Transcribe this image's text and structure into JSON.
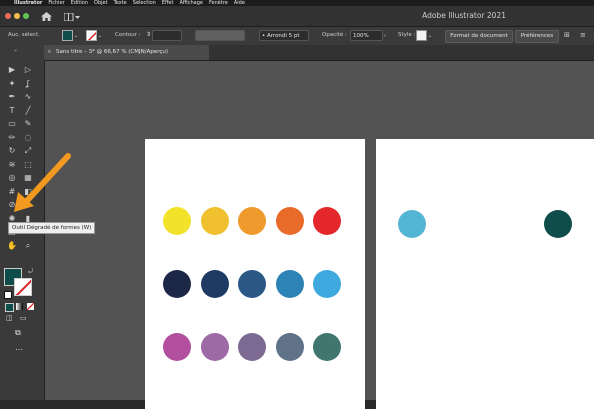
{
  "menubar": {
    "app": "Illustrator",
    "items": [
      "Fichier",
      "Edition",
      "Objet",
      "Texte",
      "Sélection",
      "Effet",
      "Affichage",
      "Fenêtre",
      "Aide"
    ]
  },
  "titlebar": {
    "title": "Adobe Illustrator 2021"
  },
  "control": {
    "selection_label": "Auc. sélect.",
    "fill_color": "#0f4d4a",
    "stroke_label": "Contour :",
    "brush_value": "Arrondi 5 pt",
    "opacity_label": "Opacité :",
    "opacity_value": "100%",
    "style_label": "Style :",
    "doc_format_button": "Format de document",
    "prefs_button": "Préférences"
  },
  "tab": {
    "label": "Sans titre – 3* @ 66,67 % (CMJN/Aperçu)"
  },
  "tooltip": {
    "text": "Outil Dégradé de formes (W)"
  },
  "tools": {
    "fill_color": "#0f4d4a",
    "items": [
      "selection-tool",
      "direct-selection-tool",
      "magic-wand-tool",
      "lasso-tool",
      "pen-tool",
      "curvature-tool",
      "type-tool",
      "line-tool",
      "rectangle-tool",
      "paintbrush-tool",
      "pencil-tool",
      "eraser-tool",
      "rotate-tool",
      "scale-tool",
      "warp-tool",
      "free-transform-tool",
      "shape-builder-tool",
      "perspective-tool",
      "mesh-tool",
      "gradient-tool",
      "eyedropper-tool",
      "blend-tool",
      "symbol-sprayer-tool",
      "graph-tool",
      "artboard-tool",
      "slice-tool",
      "hand-tool",
      "zoom-tool"
    ]
  },
  "artboard1": {
    "rows": [
      [
        "#f2e22a",
        "#f1c02e",
        "#ee9a2c",
        "#e86b2a",
        "#e3272a"
      ],
      [
        "#1d2746",
        "#1f3a63",
        "#2a5784",
        "#2d83b6",
        "#3ea8df"
      ],
      [
        "#b24f9e",
        "#9d6aa6",
        "#7d6a92",
        "#5f7288",
        "#3f7770"
      ]
    ]
  },
  "artboard2": {
    "dots": [
      "#52b6d2",
      "#0f4d4a"
    ]
  },
  "annotation": {
    "arrow_color": "#f29a1f"
  }
}
